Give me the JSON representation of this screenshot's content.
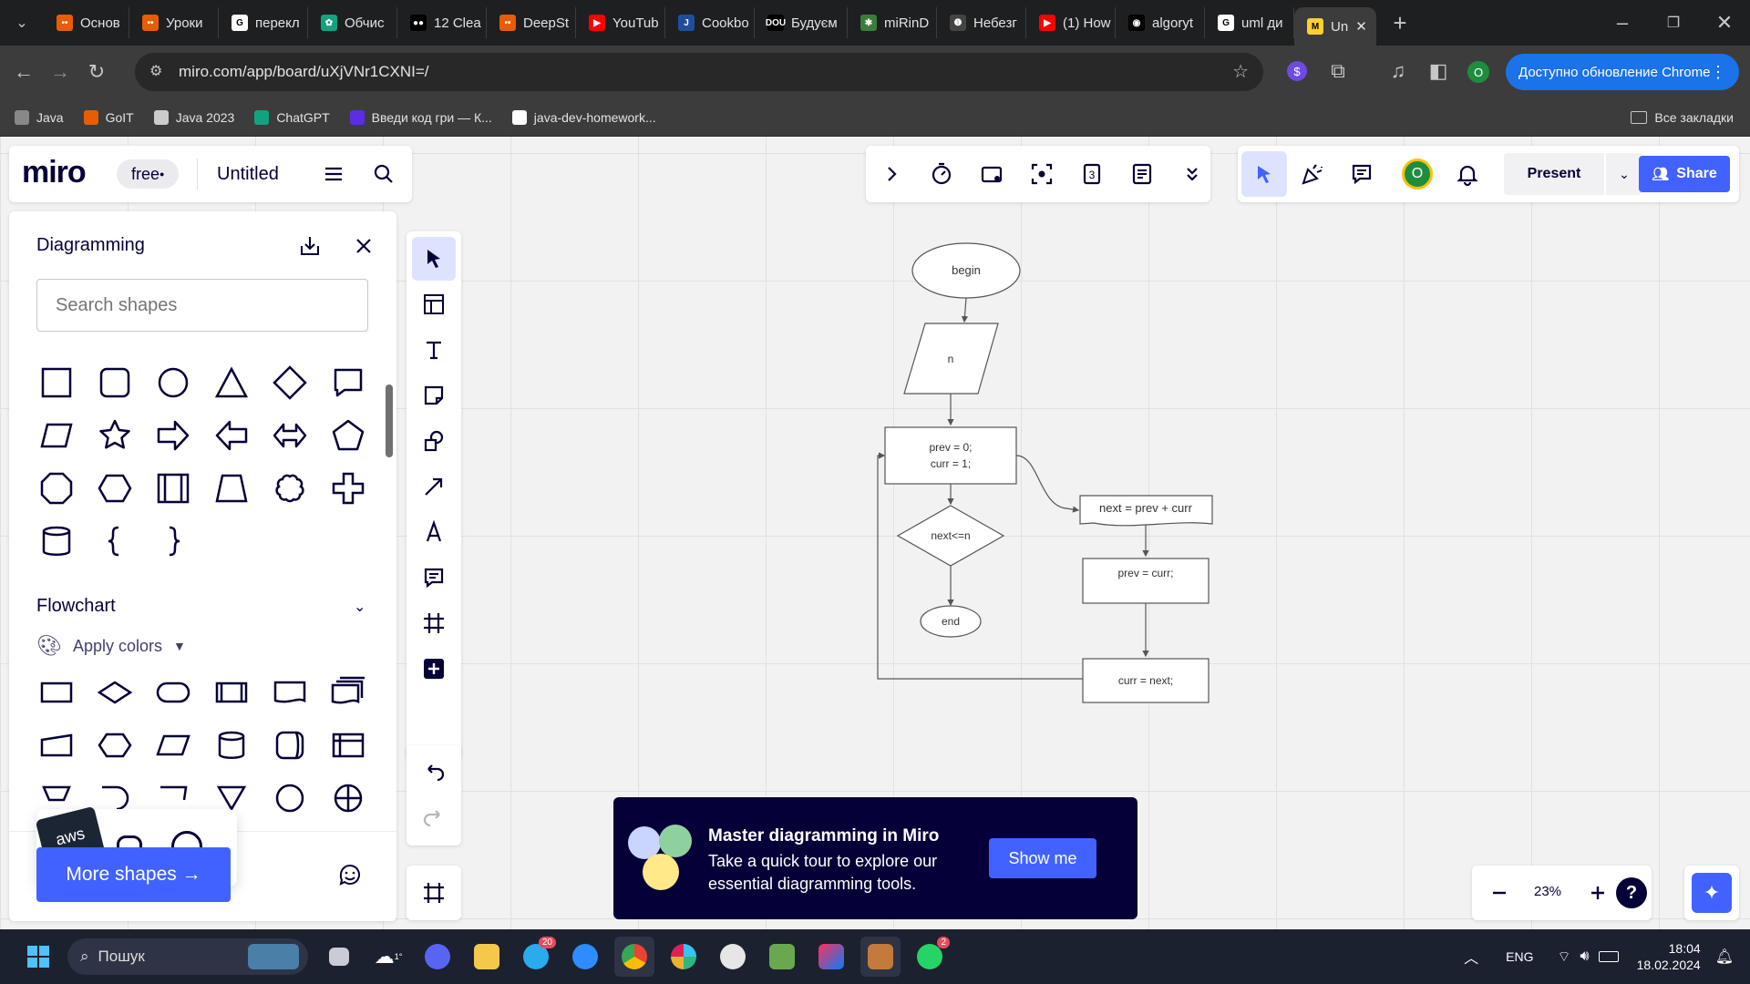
{
  "browser": {
    "tabs": [
      {
        "title": "Основ",
        "fav": "#e85d04",
        "fav_glyph": "••"
      },
      {
        "title": "Уроки",
        "fav": "#e85d04",
        "fav_glyph": "••"
      },
      {
        "title": "перекл",
        "fav": "#ffffff",
        "fav_glyph": "G"
      },
      {
        "title": "Обчис",
        "fav": "#10a37f",
        "fav_glyph": "✿"
      },
      {
        "title": "12 Clea",
        "fav": "#000000",
        "fav_glyph": "●●"
      },
      {
        "title": "DeepSt",
        "fav": "#e85d04",
        "fav_glyph": "••"
      },
      {
        "title": "YouTub",
        "fav": "#ff0000",
        "fav_glyph": "▶"
      },
      {
        "title": "Cookbo",
        "fav": "#1f4e9c",
        "fav_glyph": "J"
      },
      {
        "title": "Будуєм",
        "fav": "#000000",
        "fav_glyph": "DOU"
      },
      {
        "title": "miRinD",
        "fav": "#3a7d3a",
        "fav_glyph": "✱"
      },
      {
        "title": "Небезг",
        "fav": "#444444",
        "fav_glyph": "❶"
      },
      {
        "title": "(1) How",
        "fav": "#ff0000",
        "fav_glyph": "▶"
      },
      {
        "title": "algoryt",
        "fav": "#000000",
        "fav_glyph": "◉"
      },
      {
        "title": "uml ди",
        "fav": "#ffffff",
        "fav_glyph": "G"
      },
      {
        "title": "Un",
        "fav": "#ffd02f",
        "fav_glyph": "M",
        "active": true
      }
    ],
    "url": "miro.com/app/board/uXjVNr1CXNI=/",
    "update_label": "Доступно обновление Chrome",
    "profile_initial": "O",
    "bookmarks": [
      {
        "label": "Java",
        "color": "#888888"
      },
      {
        "label": "GoIT",
        "color": "#e85d04"
      },
      {
        "label": "Java 2023",
        "color": "#cccccc"
      },
      {
        "label": "ChatGPT",
        "color": "#10a37f"
      },
      {
        "label": "Введи код гри — К...",
        "color": "#5b2ee5"
      },
      {
        "label": "java-dev-homework...",
        "color": "#ffffff"
      }
    ],
    "all_bookmarks": "Все закладки"
  },
  "miro": {
    "logo": "miro",
    "plan": "free",
    "board_title": "Untitled",
    "panel": {
      "title": "Diagramming",
      "search_placeholder": "Search shapes",
      "section": "Flowchart",
      "apply_colors": "Apply colors",
      "more_shapes": "More shapes →",
      "aws": "aws"
    },
    "present_label": "Present",
    "share_label": "Share",
    "top_counter": "3",
    "avatar_initial": "O",
    "zoom": "23%",
    "help": "?",
    "tour": {
      "title": "Master diagramming in Miro",
      "body": "Take a quick tour to explore our essential diagramming tools.",
      "button": "Show me"
    }
  },
  "flowchart": {
    "begin": "begin",
    "input": "n",
    "init_1": "prev = 0;",
    "init_2": "curr = 1;",
    "condition": "next<=n",
    "end": "end",
    "next": "next = prev + curr",
    "prev": "prev = curr;",
    "curr": "curr = next;"
  },
  "taskbar": {
    "search": "Пошук",
    "weather": "1°",
    "lang": "ENG",
    "time": "18:04",
    "date": "18.02.2024",
    "telegram_badge": "20",
    "whatsapp_badge": "2"
  }
}
